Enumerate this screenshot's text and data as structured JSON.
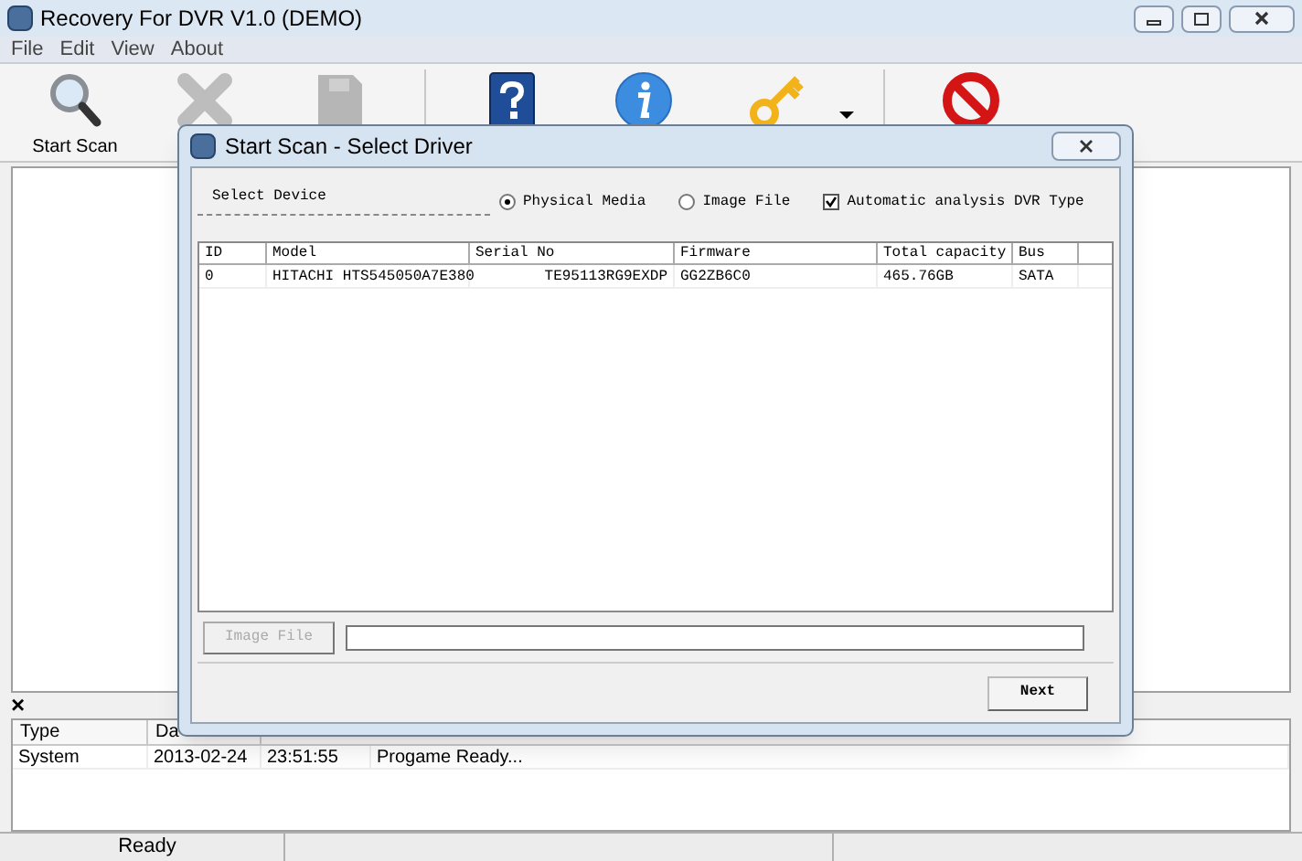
{
  "window": {
    "title": "Recovery For DVR V1.0 (DEMO)"
  },
  "menu": [
    "File",
    "Edit",
    "View",
    "About"
  ],
  "toolbar": [
    {
      "kind": "search",
      "label": "Start Scan",
      "disabled": false
    },
    {
      "kind": "stop",
      "disabled": true
    },
    {
      "kind": "save",
      "disabled": true
    },
    {
      "kind": "help",
      "disabled": false
    },
    {
      "kind": "info",
      "disabled": false
    },
    {
      "kind": "key",
      "disabled": false,
      "dropdown": true
    },
    {
      "kind": "exit",
      "disabled": false
    }
  ],
  "log": {
    "close": "×",
    "columns": [
      "Type",
      "Da"
    ],
    "rows": [
      [
        "System",
        "2013-02-24",
        "23:51:55",
        "Progame Ready..."
      ]
    ]
  },
  "status_bar": [
    "Ready"
  ],
  "dialog": {
    "title": "Start Scan - Select Driver",
    "group_label": "Select Device",
    "options": [
      {
        "label": "Physical Media",
        "kind": "radio",
        "selected": true
      },
      {
        "label": "Image File",
        "kind": "radio",
        "selected": false
      },
      {
        "label": "Automatic analysis DVR Type",
        "kind": "checkbox",
        "checked": true
      }
    ],
    "table": {
      "columns": [
        "ID",
        "Model",
        "Serial No",
        "Firmware",
        "Total capacity",
        "Bus"
      ],
      "rows": [
        [
          "0",
          "HITACHI HTS545050A7E380",
          "TE95113RG9EXDP",
          "GG2ZB6C0",
          "465.76GB",
          "SATA"
        ]
      ]
    },
    "image_button": {
      "label": "Image File",
      "disabled": true
    },
    "next": "Next"
  }
}
